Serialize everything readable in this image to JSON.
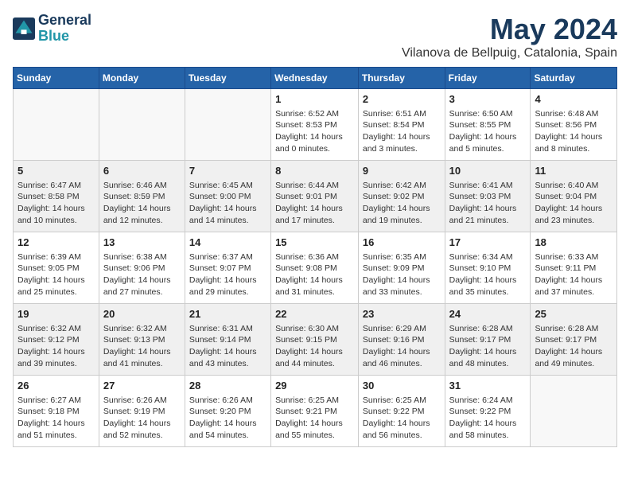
{
  "header": {
    "logo_line1": "General",
    "logo_line2": "Blue",
    "month_title": "May 2024",
    "location": "Vilanova de Bellpuig, Catalonia, Spain"
  },
  "weekdays": [
    "Sunday",
    "Monday",
    "Tuesday",
    "Wednesday",
    "Thursday",
    "Friday",
    "Saturday"
  ],
  "weeks": [
    [
      {
        "day": "",
        "info": ""
      },
      {
        "day": "",
        "info": ""
      },
      {
        "day": "",
        "info": ""
      },
      {
        "day": "1",
        "info": "Sunrise: 6:52 AM\nSunset: 8:53 PM\nDaylight: 14 hours\nand 0 minutes."
      },
      {
        "day": "2",
        "info": "Sunrise: 6:51 AM\nSunset: 8:54 PM\nDaylight: 14 hours\nand 3 minutes."
      },
      {
        "day": "3",
        "info": "Sunrise: 6:50 AM\nSunset: 8:55 PM\nDaylight: 14 hours\nand 5 minutes."
      },
      {
        "day": "4",
        "info": "Sunrise: 6:48 AM\nSunset: 8:56 PM\nDaylight: 14 hours\nand 8 minutes."
      }
    ],
    [
      {
        "day": "5",
        "info": "Sunrise: 6:47 AM\nSunset: 8:58 PM\nDaylight: 14 hours\nand 10 minutes."
      },
      {
        "day": "6",
        "info": "Sunrise: 6:46 AM\nSunset: 8:59 PM\nDaylight: 14 hours\nand 12 minutes."
      },
      {
        "day": "7",
        "info": "Sunrise: 6:45 AM\nSunset: 9:00 PM\nDaylight: 14 hours\nand 14 minutes."
      },
      {
        "day": "8",
        "info": "Sunrise: 6:44 AM\nSunset: 9:01 PM\nDaylight: 14 hours\nand 17 minutes."
      },
      {
        "day": "9",
        "info": "Sunrise: 6:42 AM\nSunset: 9:02 PM\nDaylight: 14 hours\nand 19 minutes."
      },
      {
        "day": "10",
        "info": "Sunrise: 6:41 AM\nSunset: 9:03 PM\nDaylight: 14 hours\nand 21 minutes."
      },
      {
        "day": "11",
        "info": "Sunrise: 6:40 AM\nSunset: 9:04 PM\nDaylight: 14 hours\nand 23 minutes."
      }
    ],
    [
      {
        "day": "12",
        "info": "Sunrise: 6:39 AM\nSunset: 9:05 PM\nDaylight: 14 hours\nand 25 minutes."
      },
      {
        "day": "13",
        "info": "Sunrise: 6:38 AM\nSunset: 9:06 PM\nDaylight: 14 hours\nand 27 minutes."
      },
      {
        "day": "14",
        "info": "Sunrise: 6:37 AM\nSunset: 9:07 PM\nDaylight: 14 hours\nand 29 minutes."
      },
      {
        "day": "15",
        "info": "Sunrise: 6:36 AM\nSunset: 9:08 PM\nDaylight: 14 hours\nand 31 minutes."
      },
      {
        "day": "16",
        "info": "Sunrise: 6:35 AM\nSunset: 9:09 PM\nDaylight: 14 hours\nand 33 minutes."
      },
      {
        "day": "17",
        "info": "Sunrise: 6:34 AM\nSunset: 9:10 PM\nDaylight: 14 hours\nand 35 minutes."
      },
      {
        "day": "18",
        "info": "Sunrise: 6:33 AM\nSunset: 9:11 PM\nDaylight: 14 hours\nand 37 minutes."
      }
    ],
    [
      {
        "day": "19",
        "info": "Sunrise: 6:32 AM\nSunset: 9:12 PM\nDaylight: 14 hours\nand 39 minutes."
      },
      {
        "day": "20",
        "info": "Sunrise: 6:32 AM\nSunset: 9:13 PM\nDaylight: 14 hours\nand 41 minutes."
      },
      {
        "day": "21",
        "info": "Sunrise: 6:31 AM\nSunset: 9:14 PM\nDaylight: 14 hours\nand 43 minutes."
      },
      {
        "day": "22",
        "info": "Sunrise: 6:30 AM\nSunset: 9:15 PM\nDaylight: 14 hours\nand 44 minutes."
      },
      {
        "day": "23",
        "info": "Sunrise: 6:29 AM\nSunset: 9:16 PM\nDaylight: 14 hours\nand 46 minutes."
      },
      {
        "day": "24",
        "info": "Sunrise: 6:28 AM\nSunset: 9:17 PM\nDaylight: 14 hours\nand 48 minutes."
      },
      {
        "day": "25",
        "info": "Sunrise: 6:28 AM\nSunset: 9:17 PM\nDaylight: 14 hours\nand 49 minutes."
      }
    ],
    [
      {
        "day": "26",
        "info": "Sunrise: 6:27 AM\nSunset: 9:18 PM\nDaylight: 14 hours\nand 51 minutes."
      },
      {
        "day": "27",
        "info": "Sunrise: 6:26 AM\nSunset: 9:19 PM\nDaylight: 14 hours\nand 52 minutes."
      },
      {
        "day": "28",
        "info": "Sunrise: 6:26 AM\nSunset: 9:20 PM\nDaylight: 14 hours\nand 54 minutes."
      },
      {
        "day": "29",
        "info": "Sunrise: 6:25 AM\nSunset: 9:21 PM\nDaylight: 14 hours\nand 55 minutes."
      },
      {
        "day": "30",
        "info": "Sunrise: 6:25 AM\nSunset: 9:22 PM\nDaylight: 14 hours\nand 56 minutes."
      },
      {
        "day": "31",
        "info": "Sunrise: 6:24 AM\nSunset: 9:22 PM\nDaylight: 14 hours\nand 58 minutes."
      },
      {
        "day": "",
        "info": ""
      }
    ]
  ]
}
